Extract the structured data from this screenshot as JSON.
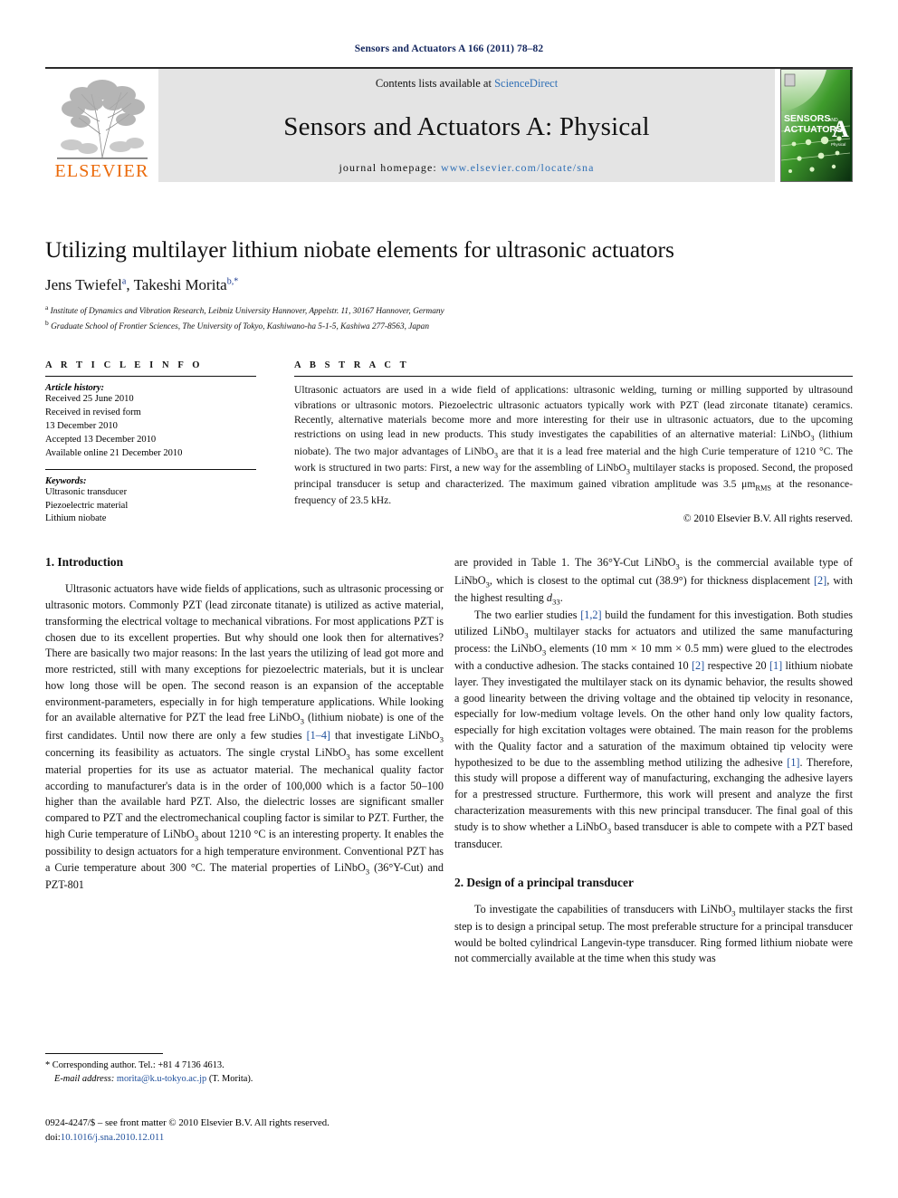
{
  "running_head": "Sensors and Actuators A 166 (2011) 78–82",
  "banner": {
    "contents_prefix": "Contents lists available at ",
    "sciencedirect": "ScienceDirect",
    "journal_title": "Sensors and Actuators A: Physical",
    "homepage_prefix": "journal homepage:",
    "homepage_url": "www.elsevier.com/locate/sna",
    "publisher_wordmark": "ELSEVIER",
    "cover": {
      "line1": "SENSORS",
      "line1_small": "AND",
      "line2": "ACTUATORS",
      "letter": "A",
      "sub": "Physical"
    },
    "colors": {
      "elsevier_orange": "#eb6a0a",
      "link_blue": "#2f6fb5",
      "banner_grey": "#e4e4e4",
      "cover_green": "#4aa72e"
    }
  },
  "article": {
    "title": "Utilizing multilayer lithium niobate elements for ultrasonic actuators",
    "authors": [
      {
        "name": "Jens Twiefel",
        "marks": "a"
      },
      {
        "name": "Takeshi Morita",
        "marks": "b,*"
      }
    ],
    "affiliations": [
      {
        "mark": "a",
        "text": "Institute of Dynamics and Vibration Research, Leibniz University Hannover, Appelstr. 11, 30167 Hannover, Germany"
      },
      {
        "mark": "b",
        "text": "Graduate School of Frontier Sciences, The University of Tokyo, Kashiwano-ha 5-1-5, Kashiwa 277-8563, Japan"
      }
    ]
  },
  "article_info": {
    "heading": "A R T I C L E    I N F O",
    "history_label": "Article history:",
    "history": [
      "Received 25 June 2010",
      "Received in revised form",
      "13 December 2010",
      "Accepted 13 December 2010",
      "Available online 21 December 2010"
    ],
    "keywords_label": "Keywords:",
    "keywords": [
      "Ultrasonic transducer",
      "Piezoelectric material",
      "Lithium niobate"
    ]
  },
  "abstract": {
    "heading": "A B S T R A C T",
    "text": "Ultrasonic actuators are used in a wide field of applications: ultrasonic welding, turning or milling supported by ultrasound vibrations or ultrasonic motors. Piezoelectric ultrasonic actuators typically work with PZT (lead zirconate titanate) ceramics. Recently, alternative materials become more and more interesting for their use in ultrasonic actuators, due to the upcoming restrictions on using lead in new products. This study investigates the capabilities of an alternative material: LiNbO3 (lithium niobate). The two major advantages of LiNbO3 are that it is a lead free material and the high Curie temperature of 1210 °C. The work is structured in two parts: First, a new way for the assembling of LiNbO3 multilayer stacks is proposed. Second, the proposed principal transducer is setup and characterized. The maximum gained vibration amplitude was 3.5 μmRMS at the resonance-frequency of 23.5 kHz.",
    "copyright": "© 2010 Elsevier B.V. All rights reserved."
  },
  "sections": {
    "intro_heading": "1. Introduction",
    "intro_p1": "Ultrasonic actuators have wide fields of applications, such as ultrasonic processing or ultrasonic motors. Commonly PZT (lead zirconate titanate) is utilized as active material, transforming the electrical voltage to mechanical vibrations. For most applications PZT is chosen due to its excellent properties. But why should one look then for alternatives? There are basically two major reasons: In the last years the utilizing of lead got more and more restricted, still with many exceptions for piezoelectric materials, but it is unclear how long those will be open. The second reason is an expansion of the acceptable environment-parameters, especially in for high temperature applications. While looking for an available alternative for PZT the lead free LiNbO3 (lithium niobate) is one of the first candidates. Until now there are only a few studies [1–4] that investigate LiNbO3 concerning its feasibility as actuators. The single crystal LiNbO3 has some excellent material properties for its use as actuator material. The mechanical quality factor according to manufacturer's data is in the order of 100,000 which is a factor 50–100 higher than the available hard PZT. Also, the dielectric losses are significant smaller compared to PZT and the electromechanical coupling factor is similar to PZT. Further, the high Curie temperature of LiNbO3 about 1210 °C is an interesting property. It enables the possibility to design actuators for a high temperature environment. Conventional PZT has a Curie temperature about 300 °C. The material properties of LiNbO3 (36°Y-Cut) and PZT-801",
    "intro_p1_cont": "are provided in Table 1. The 36°Y-Cut LiNbO3 is the commercial available type of LiNbO3, which is closest to the optimal cut (38.9°) for thickness displacement [2], with the highest resulting d33.",
    "intro_p2": "The two earlier studies [1,2] build the fundament for this investigation. Both studies utilized LiNbO3 multilayer stacks for actuators and utilized the same manufacturing process: the LiNbO3 elements (10 mm × 10 mm × 0.5 mm) were glued to the electrodes with a conductive adhesion. The stacks contained 10 [2] respective 20 [1] lithium niobate layer. They investigated the multilayer stack on its dynamic behavior, the results showed a good linearity between the driving voltage and the obtained tip velocity in resonance, especially for low-medium voltage levels. On the other hand only low quality factors, especially for high excitation voltages were obtained. The main reason for the problems with the Quality factor and a saturation of the maximum obtained tip velocity were hypothesized to be due to the assembling method utilizing the adhesive [1]. Therefore, this study will propose a different way of manufacturing, exchanging the adhesive layers for a prestressed structure. Furthermore, this work will present and analyze the first characterization measurements with this new principal transducer. The final goal of this study is to show whether a LiNbO3 based transducer is able to compete with a PZT based transducer.",
    "design_heading": "2. Design of a principal transducer",
    "design_p1": "To investigate the capabilities of transducers with LiNbO3 multilayer stacks the first step is to design a principal setup. The most preferable structure for a principal transducer would be bolted cylindrical Langevin-type transducer. Ring formed lithium niobate were not commercially available at the time when this study was"
  },
  "footnote": {
    "corresponding": "* Corresponding author. Tel.: +81 4 7136 4613.",
    "email_label": "E-mail address:",
    "email": "morita@k.u-tokyo.ac.jp",
    "email_suffix": "(T. Morita)."
  },
  "imprint": {
    "line1": "0924-4247/$ – see front matter © 2010 Elsevier B.V. All rights reserved.",
    "doi_label": "doi:",
    "doi": "10.1016/j.sna.2010.12.011"
  }
}
